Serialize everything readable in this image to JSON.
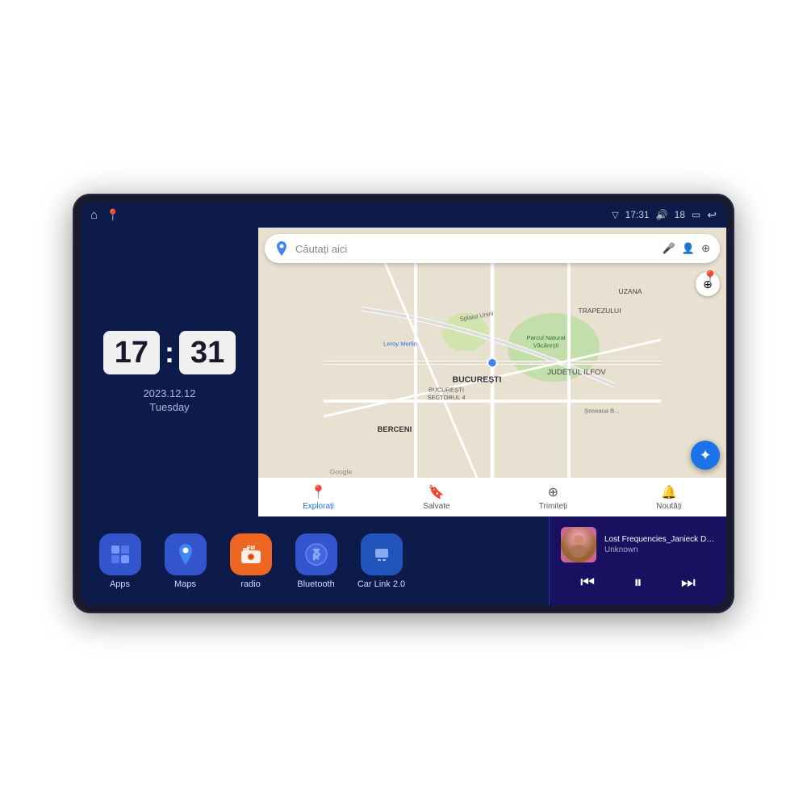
{
  "device": {
    "screen_bg": "#0d1b4b"
  },
  "status_bar": {
    "left_icons": [
      "🏠",
      "📍"
    ],
    "time": "17:31",
    "signal_icon": "▽",
    "volume_icon": "🔊",
    "volume_level": "18",
    "battery_icon": "🔋",
    "back_icon": "↩"
  },
  "clock": {
    "hours": "17",
    "minutes": "31",
    "date": "2023.12.12",
    "day": "Tuesday"
  },
  "map": {
    "search_placeholder": "Căutați aici",
    "nav_items": [
      {
        "label": "Explorați",
        "icon": "📍",
        "active": true
      },
      {
        "label": "Salvate",
        "icon": "🔖",
        "active": false
      },
      {
        "label": "Trimiteți",
        "icon": "🔗",
        "active": false
      },
      {
        "label": "Noutăți",
        "icon": "🔔",
        "active": false
      }
    ],
    "places": [
      "BERCENI",
      "BUCUREȘTI",
      "JUDEȚUL ILFOV",
      "TRAPEZULUI",
      "UZANA"
    ],
    "streets": [
      "Splaiul Unirii",
      "Șoseaua B..."
    ],
    "poi": [
      "Leroy Merlin",
      "Parcul Natural Văcărești",
      "BUCUREȘTI SECTORUL 4"
    ]
  },
  "apps": [
    {
      "id": "apps",
      "label": "Apps",
      "icon": "⊞",
      "color_class": "icon-apps"
    },
    {
      "id": "maps",
      "label": "Maps",
      "icon": "🗺",
      "color_class": "icon-maps"
    },
    {
      "id": "radio",
      "label": "radio",
      "icon": "📻",
      "color_class": "icon-radio"
    },
    {
      "id": "bluetooth",
      "label": "Bluetooth",
      "icon": "🔷",
      "color_class": "icon-bluetooth"
    },
    {
      "id": "carlink",
      "label": "Car Link 2.0",
      "icon": "📱",
      "color_class": "icon-carlink"
    }
  ],
  "music": {
    "title": "Lost Frequencies_Janieck Devy-...",
    "artist": "Unknown",
    "prev_icon": "⏮",
    "play_icon": "⏸",
    "next_icon": "⏭"
  }
}
